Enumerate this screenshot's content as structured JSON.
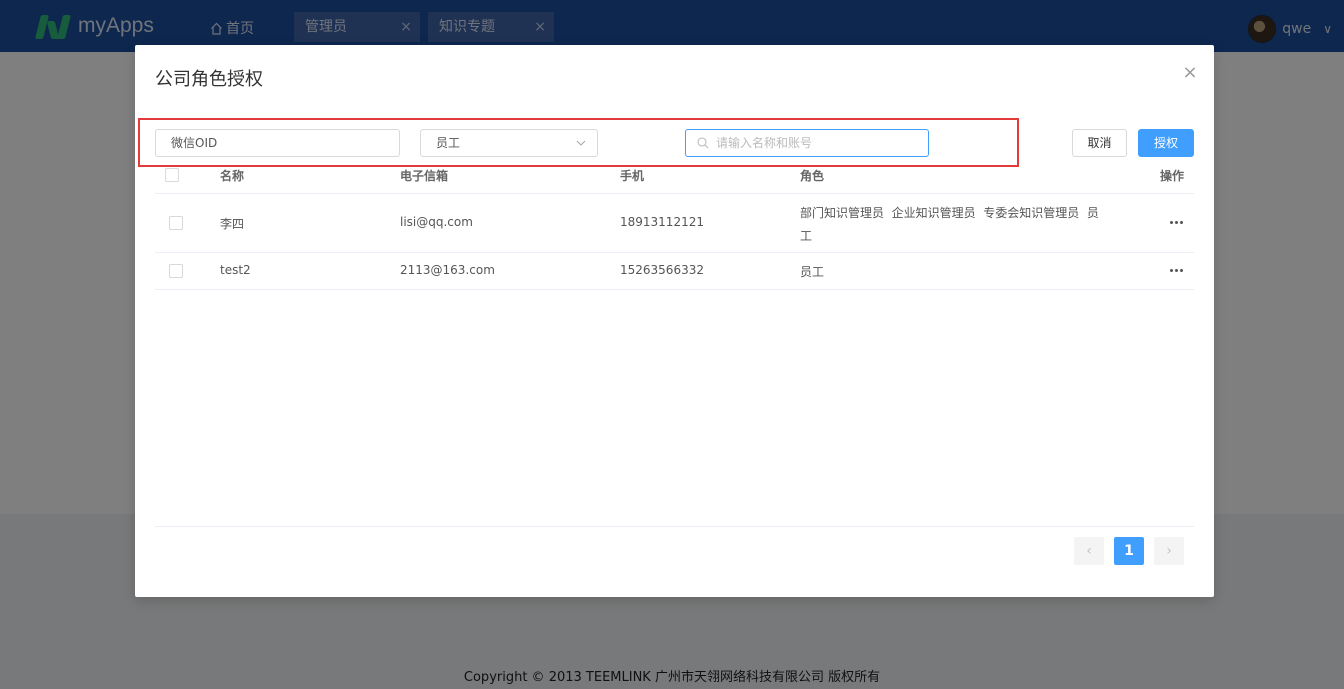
{
  "header": {
    "app_name": "myApps",
    "home_label": "首页",
    "tabs": [
      {
        "label": "管理员",
        "close": "×"
      },
      {
        "label": "知识专题",
        "close": "×"
      }
    ],
    "user_name": "qwe",
    "user_chevron": "∨"
  },
  "footer": {
    "text": "Copyright © 2013 TEEMLINK 广州市天翎网络科技有限公司 版权所有"
  },
  "modal": {
    "title": "公司角色授权",
    "close": "×",
    "filters": {
      "oid_value": "微信OID",
      "role_value": "员工",
      "search_placeholder": "请输入名称和账号"
    },
    "buttons": {
      "cancel": "取消",
      "authorize": "授权"
    },
    "table": {
      "columns": {
        "name": "名称",
        "email": "电子信箱",
        "phone": "手机",
        "role": "角色",
        "actions": "操作"
      },
      "rows": [
        {
          "name": "李四",
          "email": "lisi@qq.com",
          "phone": "18913112121",
          "role_line1": "部门知识管理员  企业知识管理员  专委会知识管理员  员",
          "role_line2": "工"
        },
        {
          "name": "test2",
          "email": "2113@163.com",
          "phone": "15263566332",
          "role_line1": "员工",
          "role_line2": ""
        }
      ]
    },
    "pagination": {
      "prev": "‹",
      "current": "1",
      "next": "›"
    }
  },
  "colors": {
    "header_bg": "#1d4e9c",
    "primary": "#409eff",
    "highlight": "#e23b3b",
    "logo_green": "#2db87a"
  }
}
